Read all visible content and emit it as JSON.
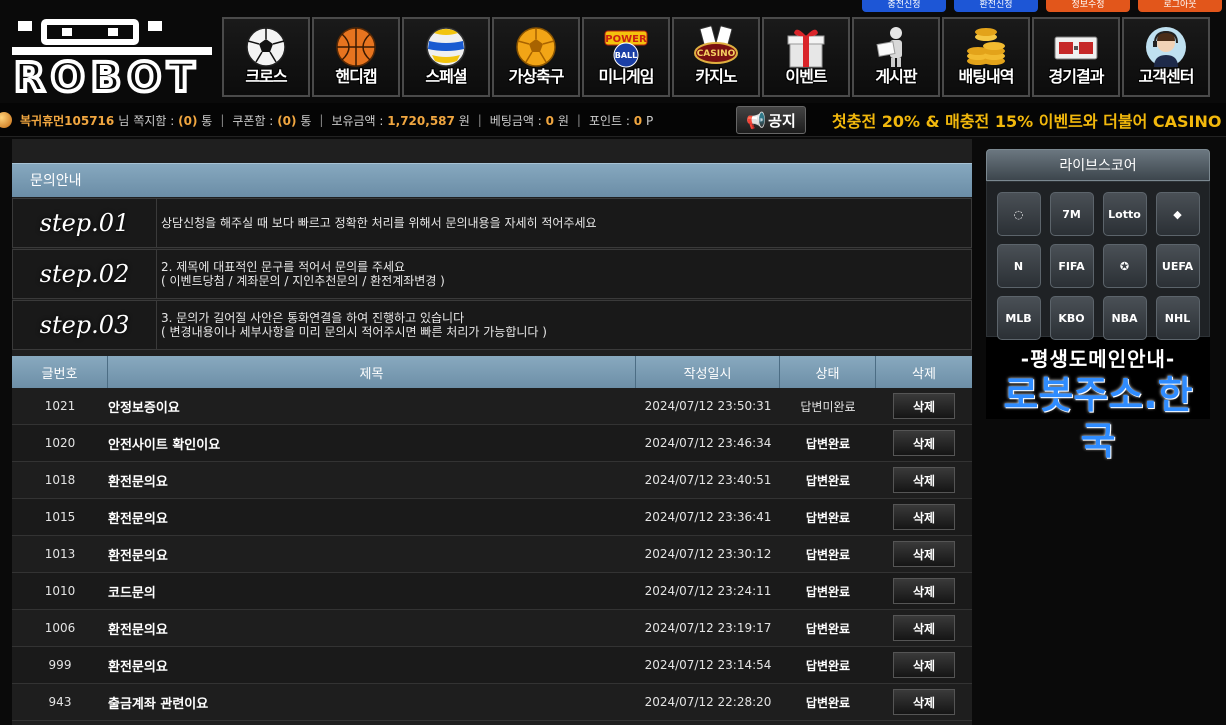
{
  "top_buttons": [
    {
      "label": "충전신청",
      "color": "#1d56d6"
    },
    {
      "label": "환전신청",
      "color": "#1d56d6"
    },
    {
      "label": "정보수정",
      "color": "#e2561b"
    },
    {
      "label": "로그아웃",
      "color": "#e2561b"
    }
  ],
  "logo": {
    "text": "ROBOT"
  },
  "nav": [
    {
      "label": "크로스",
      "icon": "soccer-ball-icon"
    },
    {
      "label": "핸디캡",
      "icon": "basketball-icon"
    },
    {
      "label": "스페셜",
      "icon": "volleyball-icon"
    },
    {
      "label": "가상축구",
      "icon": "gold-soccer-ball-icon"
    },
    {
      "label": "미니게임",
      "icon": "powerball-icon"
    },
    {
      "label": "카지노",
      "icon": "casino-icon"
    },
    {
      "label": "이벤트",
      "icon": "gift-icon"
    },
    {
      "label": "게시판",
      "icon": "board-icon"
    },
    {
      "label": "배팅내역",
      "icon": "coins-icon"
    },
    {
      "label": "경기결과",
      "icon": "scoreboard-icon"
    },
    {
      "label": "고객센터",
      "icon": "headset-icon"
    }
  ],
  "user": {
    "name": "복귀휴먼105716",
    "suffix": "님",
    "msg_label": "쪽지함 :",
    "msg_count": "(0)",
    "msg_unit": "통",
    "coupon_label": "쿠폰함 :",
    "coupon_count": "(0)",
    "coupon_unit": "통",
    "balance_label": "보유금액 :",
    "balance": "1,720,587",
    "balance_unit": "원",
    "bet_label": "베팅금액 :",
    "bet": "0",
    "bet_unit": "원",
    "point_label": "포인트 :",
    "point": "0",
    "point_unit": "P"
  },
  "notice": {
    "badge": "공지",
    "text": "첫충전 20% & 매충전 15% 이벤트와 더불어 CASINO"
  },
  "section_title": "문의안내",
  "steps": [
    {
      "no": "step.01",
      "lines": [
        "상담신청을 해주실 때 보다 빠르고 정확한 처리를 위해서 문의내용을 자세히 적어주세요"
      ]
    },
    {
      "no": "step.02",
      "lines": [
        "2. 제목에 대표적인 문구를 적어서 문의를 주세요",
        "( 이벤트당첨 / 계좌문의 / 지인추천문의 / 환전계좌변경 )"
      ]
    },
    {
      "no": "step.03",
      "lines": [
        "3. 문의가 길어질 사안은 통화연결을 하여 진행하고 있습니다",
        "( 변경내용이나 세부사항을 미리 문의시 적어주시면 빠른 처리가 가능합니다 )"
      ]
    }
  ],
  "table": {
    "headers": [
      "글번호",
      "제목",
      "작성일시",
      "상태",
      "삭제"
    ],
    "rows": [
      {
        "no": "1021",
        "subject": "안정보증이요",
        "date": "2024/07/12 23:50:31",
        "status": "답변미완료",
        "del": "삭제"
      },
      {
        "no": "1020",
        "subject": "안전사이트 확인이요",
        "date": "2024/07/12 23:46:34",
        "status": "답변완료",
        "del": "삭제"
      },
      {
        "no": "1018",
        "subject": "환전문의요",
        "date": "2024/07/12 23:40:51",
        "status": "답변완료",
        "del": "삭제"
      },
      {
        "no": "1015",
        "subject": "환전문의요",
        "date": "2024/07/12 23:36:41",
        "status": "답변완료",
        "del": "삭제"
      },
      {
        "no": "1013",
        "subject": "환전문의요",
        "date": "2024/07/12 23:30:12",
        "status": "답변완료",
        "del": "삭제"
      },
      {
        "no": "1010",
        "subject": "코드문의",
        "date": "2024/07/12 23:24:11",
        "status": "답변완료",
        "del": "삭제"
      },
      {
        "no": "1006",
        "subject": "환전문의요",
        "date": "2024/07/12 23:19:17",
        "status": "답변완료",
        "del": "삭제"
      },
      {
        "no": "999",
        "subject": "환전문의요",
        "date": "2024/07/12 23:14:54",
        "status": "답변완료",
        "del": "삭제"
      },
      {
        "no": "943",
        "subject": "출금계좌 관련이요",
        "date": "2024/07/12 22:28:20",
        "status": "답변완료",
        "del": "삭제"
      }
    ]
  },
  "livescore": {
    "title": "라이브스코어",
    "icons": [
      {
        "name": "loading-ring-icon",
        "text": "◌"
      },
      {
        "name": "7m-icon",
        "text": "7M"
      },
      {
        "name": "lotto-icon",
        "text": "Lotto"
      },
      {
        "name": "red-diamonds-icon",
        "text": "◆"
      },
      {
        "name": "naver-icon",
        "text": "N"
      },
      {
        "name": "fifa-icon",
        "text": "FIFA"
      },
      {
        "name": "champions-league-icon",
        "text": "✪"
      },
      {
        "name": "uefa-icon",
        "text": "UEFA"
      },
      {
        "name": "mlb-icon",
        "text": "MLB"
      },
      {
        "name": "kbo-icon",
        "text": "KBO"
      },
      {
        "name": "nba-icon",
        "text": "NBA"
      },
      {
        "name": "nhl-icon",
        "text": "NHL"
      }
    ]
  },
  "domain": {
    "top": "-평생도메인안내-",
    "main": "로봇주소.한국"
  }
}
